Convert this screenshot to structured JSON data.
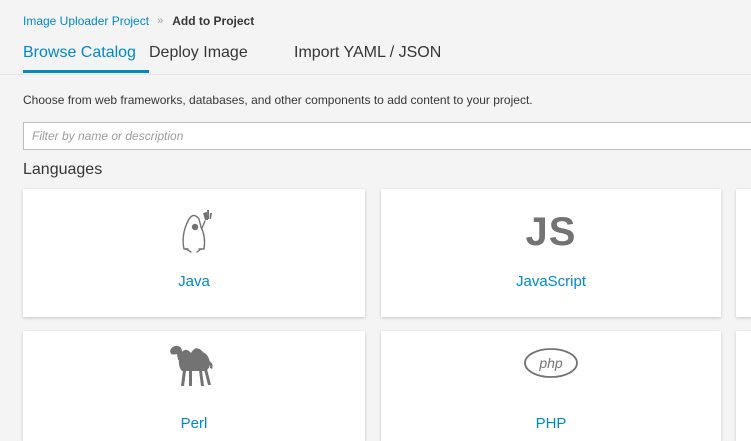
{
  "breadcrumb": {
    "project": "Image Uploader Project",
    "separator": "»",
    "current": "Add to Project"
  },
  "tabs": [
    {
      "label": "Browse Catalog",
      "active": true
    },
    {
      "label": "Deploy Image",
      "active": false
    },
    {
      "label": "Import YAML / JSON",
      "active": false
    }
  ],
  "description": "Choose from web frameworks, databases, and other components to add content to your project.",
  "filter": {
    "placeholder": "Filter by name or description",
    "value": ""
  },
  "section": {
    "title": "Languages"
  },
  "cards": [
    {
      "label": "Java",
      "icon": "java-duke-icon"
    },
    {
      "label": "JavaScript",
      "icon": "javascript-icon",
      "icon_text": "JS"
    },
    {
      "label": "Perl",
      "icon": "perl-camel-icon"
    },
    {
      "label": "PHP",
      "icon": "php-icon"
    }
  ],
  "colors": {
    "accent": "#0088ce",
    "background": "#f4f4f4",
    "card": "#ffffff",
    "icon_gray": "#737373"
  }
}
